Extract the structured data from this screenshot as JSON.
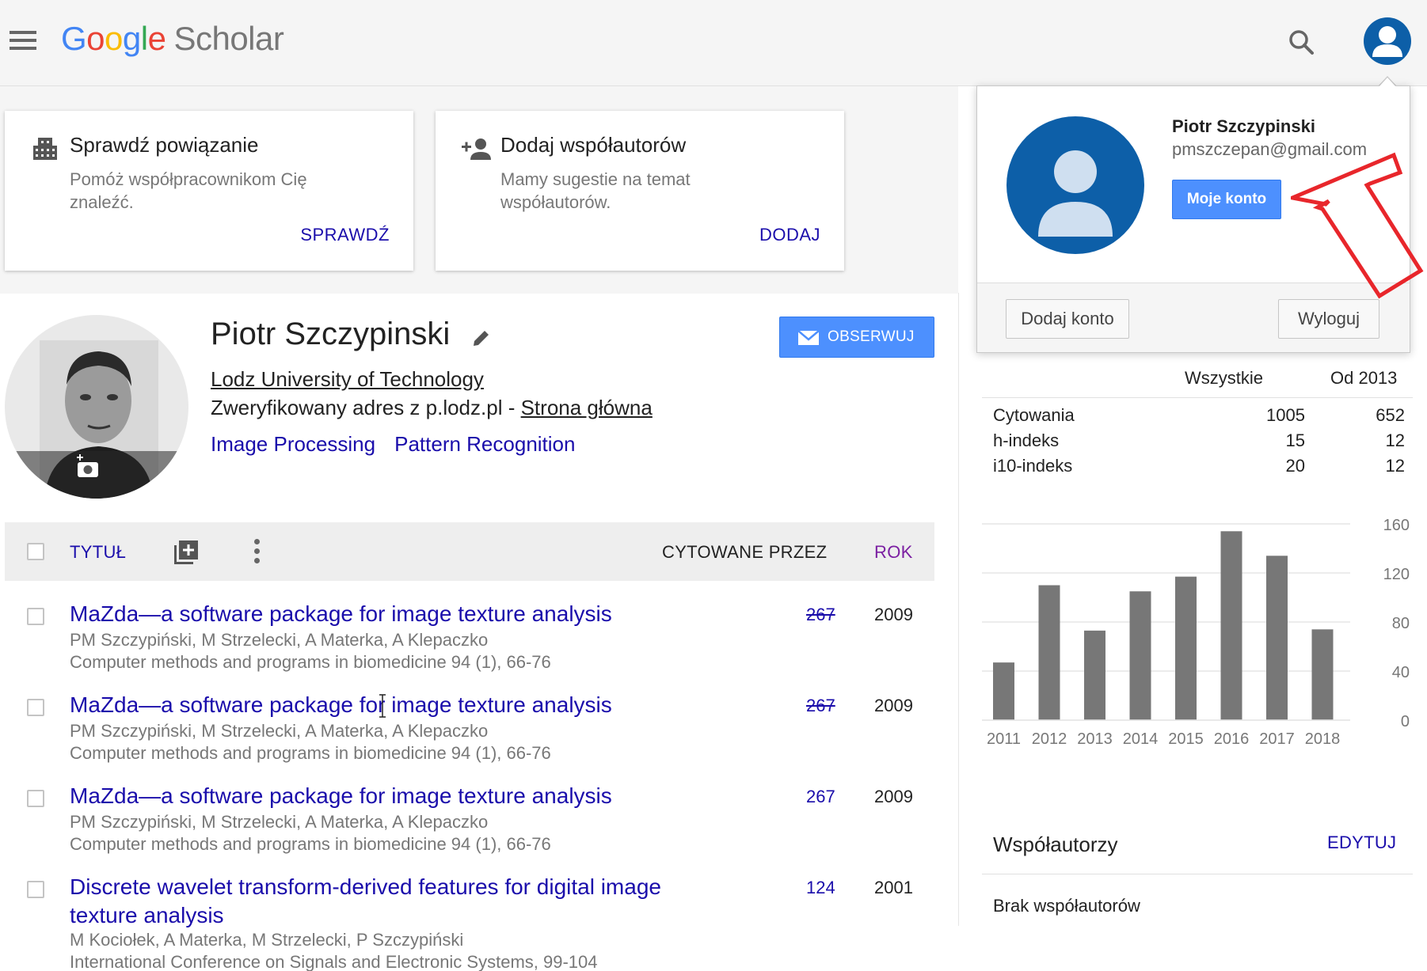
{
  "header": {
    "logo_google": [
      "G",
      "o",
      "o",
      "g",
      "l",
      "e"
    ],
    "logo_scholar": "Scholar"
  },
  "cards": [
    {
      "title": "Sprawdź powiązanie",
      "text": "Pomóż współpracownikom Cię znaleźć.",
      "action": "SPRAWDŹ",
      "icon": "building-icon"
    },
    {
      "title": "Dodaj współautorów",
      "text": "Mamy sugestie na temat współautorów.",
      "action": "DODAJ",
      "icon": "add-person-icon"
    }
  ],
  "profile": {
    "name": "Piotr Szczypinski",
    "affiliation": "Lodz University of Technology",
    "verified_prefix": "Zweryfikowany adres z p.lodz.pl - ",
    "homepage_label": "Strona główna",
    "interests": [
      "Image Processing",
      "Pattern Recognition"
    ],
    "follow_label": "OBSERWUJ"
  },
  "table": {
    "col_title": "TYTUŁ",
    "col_cited": "CYTOWANE PRZEZ",
    "col_year": "ROK"
  },
  "publications": [
    {
      "title": "MaZda—a software package for image texture analysis",
      "authors": "PM Szczypiński, M Strzelecki, A Materka, A Klepaczko",
      "venue": "Computer methods and programs in biomedicine 94 (1), 66-76",
      "cited": "267",
      "cited_strikethrough": true,
      "year": "2009"
    },
    {
      "title": "MaZda—a software package for image texture analysis",
      "authors": "PM Szczypiński, M Strzelecki, A Materka, A Klepaczko",
      "venue": "Computer methods and programs in biomedicine 94 (1), 66-76",
      "cited": "267",
      "cited_strikethrough": true,
      "year": "2009"
    },
    {
      "title": "MaZda—a software package for image texture analysis",
      "authors": "PM Szczypiński, M Strzelecki, A Materka, A Klepaczko",
      "venue": "Computer methods and programs in biomedicine 94 (1), 66-76",
      "cited": "267",
      "cited_strikethrough": false,
      "year": "2009"
    },
    {
      "title": "Discrete wavelet transform-derived features for digital image texture analysis",
      "authors": "M Kociołek, A Materka, M Strzelecki, P Szczypiński",
      "venue": "International Conference on Signals and Electronic Systems, 99-104",
      "cited": "124",
      "cited_strikethrough": false,
      "year": "2001"
    }
  ],
  "citations": {
    "col_all": "Wszystkie",
    "col_since": "Od 2013",
    "rows": [
      {
        "label": "Cytowania",
        "all": "1005",
        "since": "652"
      },
      {
        "label": "h-indeks",
        "all": "15",
        "since": "12"
      },
      {
        "label": "i10-indeks",
        "all": "20",
        "since": "12"
      }
    ]
  },
  "chart_data": {
    "type": "bar",
    "categories": [
      "2011",
      "2012",
      "2013",
      "2014",
      "2015",
      "2016",
      "2017",
      "2018"
    ],
    "values": [
      47,
      110,
      73,
      105,
      117,
      154,
      134,
      74
    ],
    "ylim": [
      0,
      160
    ],
    "yticks": [
      "0",
      "40",
      "80",
      "120",
      "160"
    ],
    "bar_color": "#777777",
    "grid": true
  },
  "coauthors": {
    "title": "Współautorzy",
    "edit_label": "EDYTUJ",
    "none_text": "Brak współautorów"
  },
  "account_popup": {
    "name": "Piotr Szczypinski",
    "email": "pmszczepan@gmail.com",
    "my_account_label": "Moje konto",
    "add_account_label": "Dodaj konto",
    "logout_label": "Wyloguj"
  },
  "colors": {
    "link": "#1a0dab",
    "button_blue": "#4d90fe",
    "avatar_blue": "#0d5fa8",
    "annotation_arrow": "#e8262b"
  }
}
